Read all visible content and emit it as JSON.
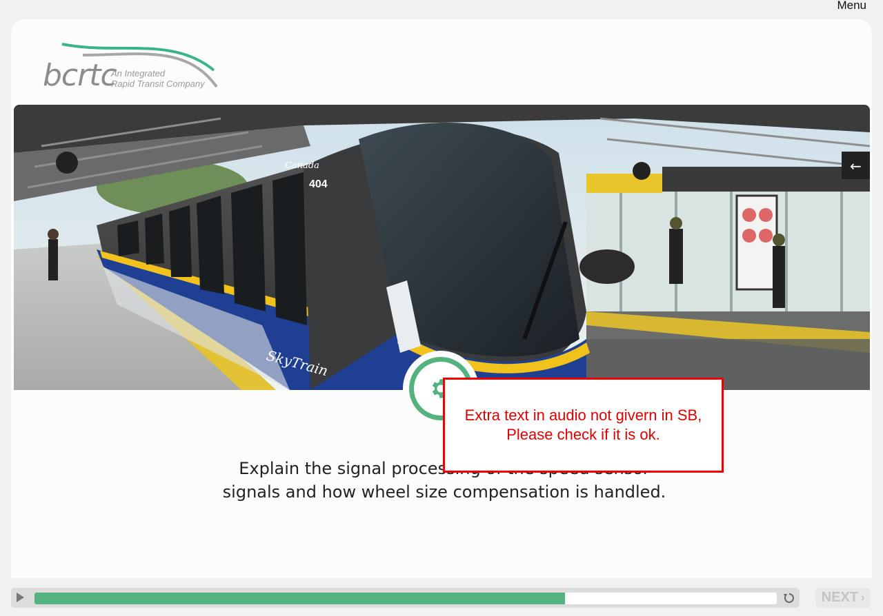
{
  "header": {
    "menu_label": "Menu"
  },
  "logo": {
    "wordmark": "bcrtc",
    "tagline_line1": "An Integrated",
    "tagline_line2": "Rapid Transit Company"
  },
  "hero": {
    "train_brand": "SkyTrain",
    "train_number": "404",
    "sponsor_text": "Canada",
    "icon": "gear-icon"
  },
  "caption": {
    "line1": "Explain the signal processing of the speed sensor",
    "line2": "signals and how wheel size compensation is handled."
  },
  "review_note": {
    "line1": "Extra text in audio not givern in SB,",
    "line2": "Please check if it is ok."
  },
  "player": {
    "progress": 0.715,
    "play_icon": "play-icon",
    "replay_icon": "replay-icon",
    "next_label": "NEXT",
    "next_chevron": "›"
  },
  "colors": {
    "accent": "#53b27e",
    "note_red": "#dd0000",
    "train_blue": "#1e3f8f",
    "train_yellow": "#f2c21c"
  }
}
